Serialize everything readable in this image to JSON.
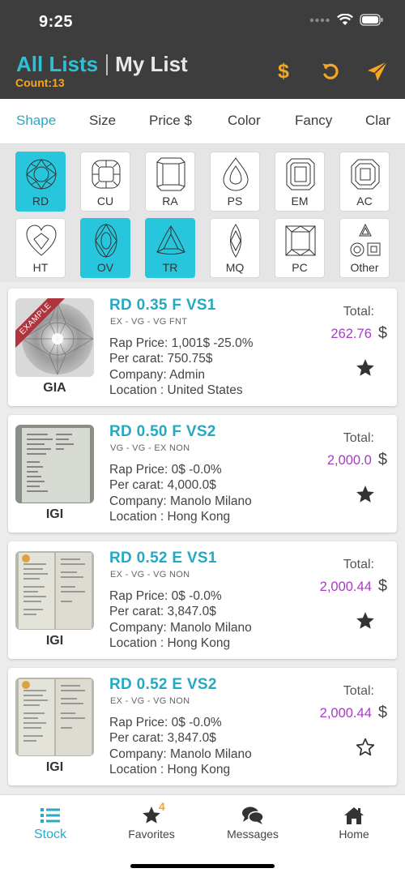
{
  "status_bar": {
    "time": "9:25"
  },
  "header": {
    "all_lists": "All Lists",
    "my_list": "My List",
    "count": "Count:13",
    "currency_button": "$"
  },
  "tabs": [
    {
      "label": "Shape",
      "active": true
    },
    {
      "label": "Size"
    },
    {
      "label": "Price $"
    },
    {
      "label": "Color"
    },
    {
      "label": "Fancy"
    },
    {
      "label": "Clar"
    }
  ],
  "shapes": [
    {
      "code": "RD",
      "selected": true
    },
    {
      "code": "CU"
    },
    {
      "code": "RA"
    },
    {
      "code": "PS"
    },
    {
      "code": "EM"
    },
    {
      "code": "AC"
    },
    {
      "code": "HT"
    },
    {
      "code": "OV",
      "selected": true
    },
    {
      "code": "TR",
      "selected": true
    },
    {
      "code": "MQ"
    },
    {
      "code": "PC"
    },
    {
      "code": "Other"
    }
  ],
  "items": [
    {
      "title": "RD 0.35 F VS1",
      "grades": "EX - VG - VG  FNT",
      "rap_price": "Rap Price: 1,001$ -25.0%",
      "per_carat": "Per carat: 750.75$",
      "company": "Company: Admin",
      "location": "Location : United States",
      "total_label": "Total:",
      "total": "262.76",
      "currency": "$",
      "lab": "GIA",
      "ribbon": "EXAMPLE",
      "favorite": true
    },
    {
      "title": "RD 0.50 F VS2",
      "grades": "VG - VG - EX  NON",
      "rap_price": "Rap Price: 0$ -0.0%",
      "per_carat": "Per carat: 4,000.0$",
      "company": "Company: Manolo Milano",
      "location": "Location : Hong Kong",
      "total_label": "Total:",
      "total": "2,000.0",
      "currency": "$",
      "lab": "IGI",
      "favorite": true
    },
    {
      "title": "RD 0.52 E VS1",
      "grades": "EX - VG - VG  NON",
      "rap_price": "Rap Price: 0$ -0.0%",
      "per_carat": "Per carat: 3,847.0$",
      "company": "Company: Manolo Milano",
      "location": "Location : Hong Kong",
      "total_label": "Total:",
      "total": "2,000.44",
      "currency": "$",
      "lab": "IGI",
      "favorite": true
    },
    {
      "title": "RD 0.52 E VS2",
      "grades": "EX - VG - VG  NON",
      "rap_price": "Rap Price: 0$ -0.0%",
      "per_carat": "Per carat: 3,847.0$",
      "company": "Company: Manolo Milano",
      "location": "Location : Hong Kong",
      "total_label": "Total:",
      "total": "2,000.44",
      "currency": "$",
      "lab": "IGI",
      "favorite": false
    }
  ],
  "bottom_nav": [
    {
      "label": "Stock",
      "icon": "list-icon",
      "active": true
    },
    {
      "label": "Favorites",
      "icon": "star-icon",
      "badge": "4"
    },
    {
      "label": "Messages",
      "icon": "messages-icon"
    },
    {
      "label": "Home",
      "icon": "home-icon"
    }
  ],
  "colors": {
    "accent": "#2aa9c5",
    "selected_shape": "#27c6dc",
    "orange": "#f5a623",
    "price_purple": "#a83bc3",
    "header_bg": "#3d3d3d"
  }
}
